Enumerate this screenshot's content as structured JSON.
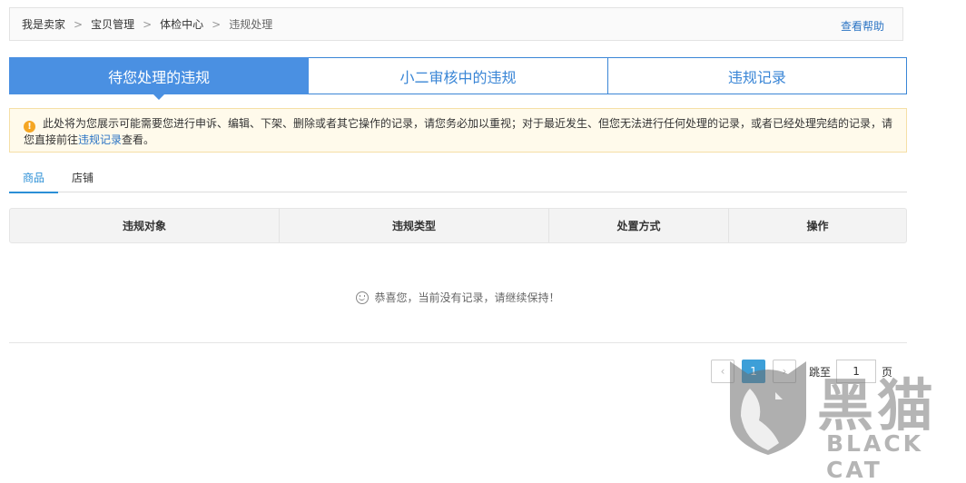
{
  "breadcrumb": {
    "items": [
      "我是卖家",
      "宝贝管理",
      "体检中心",
      "违规处理"
    ],
    "separator": ">",
    "help_link": "查看帮助"
  },
  "main_tabs": [
    {
      "label": "待您处理的违规",
      "active": true
    },
    {
      "label": "小二审核中的违规",
      "active": false
    },
    {
      "label": "违规记录",
      "active": false
    }
  ],
  "notice": {
    "text_before": "此处将为您展示可能需要您进行申诉、编辑、下架、删除或者其它操作的记录，请您务必加以重视；对于最近发生、但您无法进行任何处理的记录，或者已经处理完结的记录，请您直接前往",
    "link": "违规记录",
    "text_after": "查看。"
  },
  "sub_tabs": [
    {
      "label": "商品",
      "active": true
    },
    {
      "label": "店铺",
      "active": false
    }
  ],
  "table": {
    "columns": [
      "违规对象",
      "违规类型",
      "处置方式",
      "操作"
    ]
  },
  "empty_state": {
    "text": "恭喜您，当前没有记录，请继续保持！"
  },
  "pagination": {
    "prev": "‹",
    "current_page": "1",
    "next": "›",
    "jump_label": "跳至",
    "jump_value": "1",
    "unit": "页"
  },
  "watermark": {
    "title": "黑猫",
    "subtitle": "BLACK CAT"
  },
  "colors": {
    "accent": "#4a90e2",
    "link": "#2b74c4",
    "notice_bg": "#fffaeb",
    "warning": "#f5a623"
  }
}
